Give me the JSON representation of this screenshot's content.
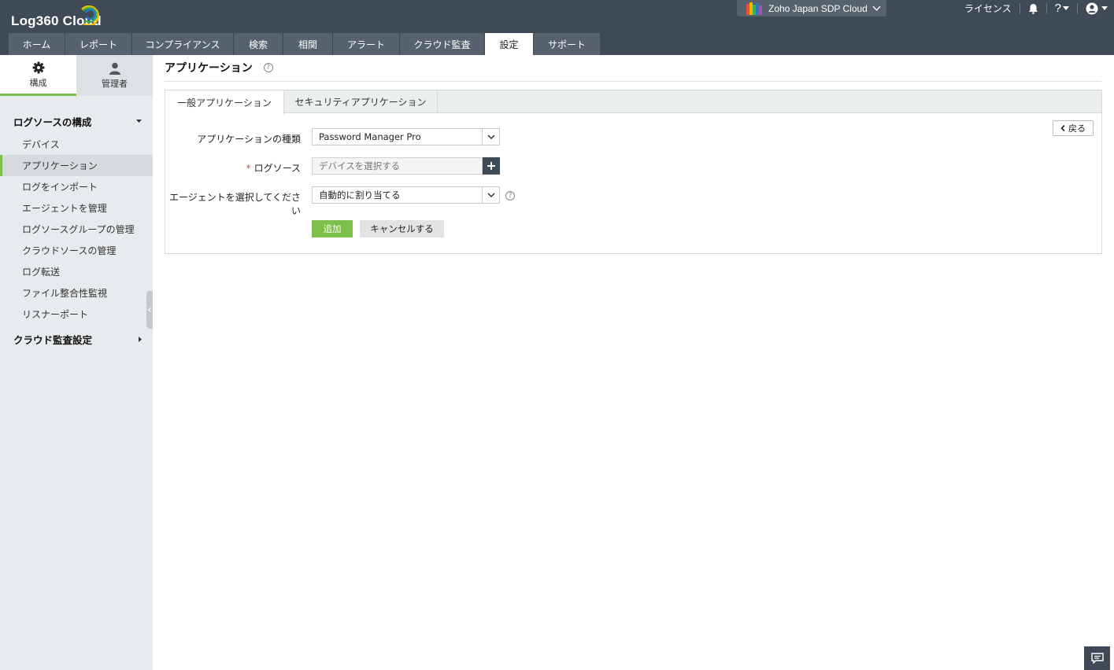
{
  "brand": {
    "name": "Log360 Cloud"
  },
  "header": {
    "org": "Zoho Japan SDP Cloud",
    "license": "ライセンス",
    "help_symbol": "?"
  },
  "nav": [
    {
      "label": "ホーム"
    },
    {
      "label": "レポート"
    },
    {
      "label": "コンプライアンス"
    },
    {
      "label": "検索"
    },
    {
      "label": "相関"
    },
    {
      "label": "アラート"
    },
    {
      "label": "クラウド監査"
    },
    {
      "label": "設定",
      "active": true
    },
    {
      "label": "サポート"
    }
  ],
  "sidebar": {
    "tabs": [
      {
        "label": "構成",
        "icon": "gear-icon",
        "active": true
      },
      {
        "label": "管理者",
        "icon": "user-icon"
      }
    ],
    "sections": [
      {
        "title": "ログソースの構成",
        "expanded": true,
        "items": [
          {
            "label": "デバイス"
          },
          {
            "label": "アプリケーション",
            "active": true
          },
          {
            "label": "ログをインポート"
          },
          {
            "label": "エージェントを管理"
          },
          {
            "label": "ログソースグループの管理"
          },
          {
            "label": "クラウドソースの管理"
          },
          {
            "label": "ログ転送"
          },
          {
            "label": "ファイル整合性監視"
          },
          {
            "label": "リスナーポート"
          }
        ]
      },
      {
        "title": "クラウド監査設定",
        "expanded": false,
        "items": []
      }
    ]
  },
  "main": {
    "title": "アプリケーション",
    "tabs": [
      {
        "label": "一般アプリケーション",
        "active": true
      },
      {
        "label": "セキュリティアプリケーション"
      }
    ],
    "back_label": "戻る",
    "form": {
      "app_type_label": "アプリケーションの種類",
      "app_type_value": "Password Manager Pro",
      "log_source_required": "*",
      "log_source_label": "ログソース",
      "log_source_placeholder": "デバイスを選択する",
      "agent_label": "エージェントを選択してください",
      "agent_value": "自動的に割り当てる",
      "add_label": "追加",
      "cancel_label": "キャンセルする"
    }
  },
  "colors": {
    "topbar": "#3e4a55",
    "tab": "#56626d",
    "accent": "#7cbf4a",
    "sidebar": "#e8ebed"
  }
}
